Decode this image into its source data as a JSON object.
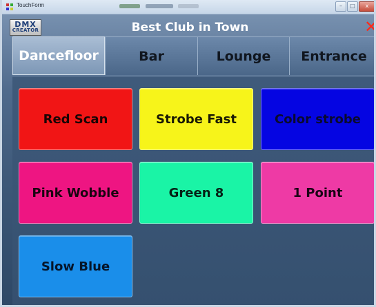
{
  "os_window": {
    "title": "TouchForm",
    "controls": [
      "–",
      "□",
      "x"
    ]
  },
  "header": {
    "logo_line1": "DMX",
    "logo_line2": "CREATOR",
    "title": "Best Club in Town",
    "close_glyph": "✕"
  },
  "tabs": [
    {
      "label": "Dancefloor",
      "active": true
    },
    {
      "label": "Bar",
      "active": false
    },
    {
      "label": "Lounge",
      "active": false
    },
    {
      "label": "Entrance",
      "active": false
    }
  ],
  "scenes": [
    {
      "label": "Red Scan",
      "color": "#f11515",
      "text_color": "#1a0505"
    },
    {
      "label": "Strobe Fast",
      "color": "#f7f41a",
      "text_color": "#1a1a05"
    },
    {
      "label": "Color strobe",
      "color": "#0505e2",
      "text_color": "#0a0a30"
    },
    {
      "label": "Pink Wobble",
      "color": "#ee1582",
      "text_color": "#1a0510"
    },
    {
      "label": "Green 8",
      "color": "#1af4a6",
      "text_color": "#052015"
    },
    {
      "label": "1 Point",
      "color": "#ee3aa5",
      "text_color": "#1a0515"
    },
    {
      "label": "Slow Blue",
      "color": "#1a8eea",
      "text_color": "#05152a"
    }
  ],
  "colors": {
    "background": "#3d5878",
    "active_tab": "#9fb4cd",
    "close_red": "#ff2a1a"
  }
}
